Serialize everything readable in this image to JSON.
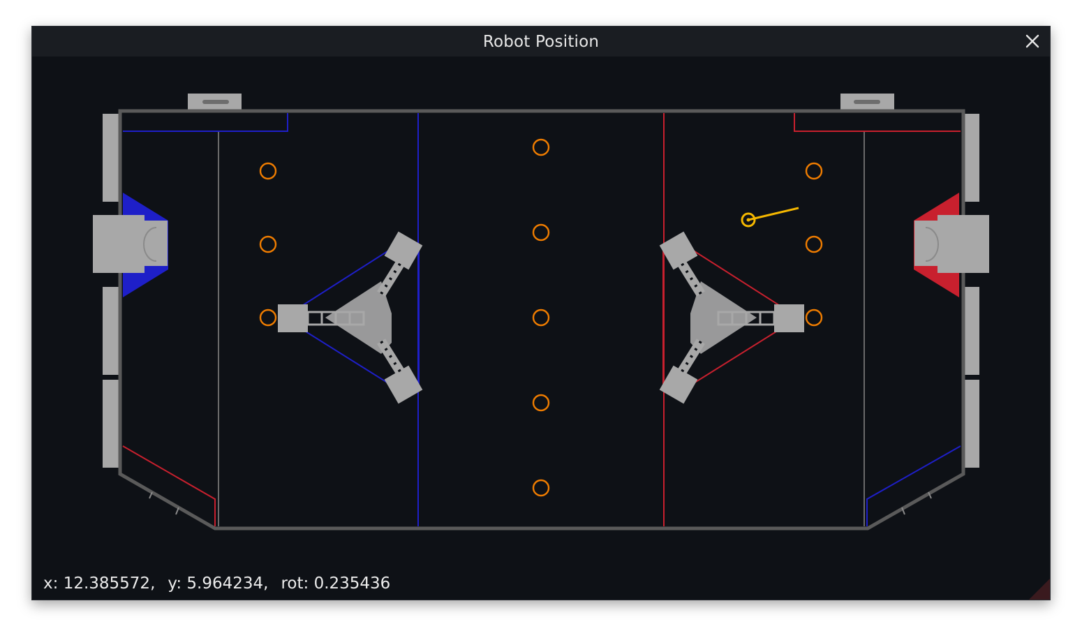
{
  "window": {
    "title": "Robot Position"
  },
  "status": {
    "x_label": "x:",
    "x_value": "12.385572,",
    "y_label": "y:",
    "y_value": "5.964234,",
    "rot_label": "rot:",
    "rot_value": "0.235436"
  },
  "colors": {
    "background": "#0e1116",
    "titlebar": "#1a1d22",
    "wall": "#5a5a5a",
    "structure": "#a8a8a8",
    "blue": "#1e1fc8",
    "red": "#c8202e",
    "cargo": "#f07d00",
    "robot": "#f5b800"
  },
  "icons": {
    "close": "close-icon"
  }
}
